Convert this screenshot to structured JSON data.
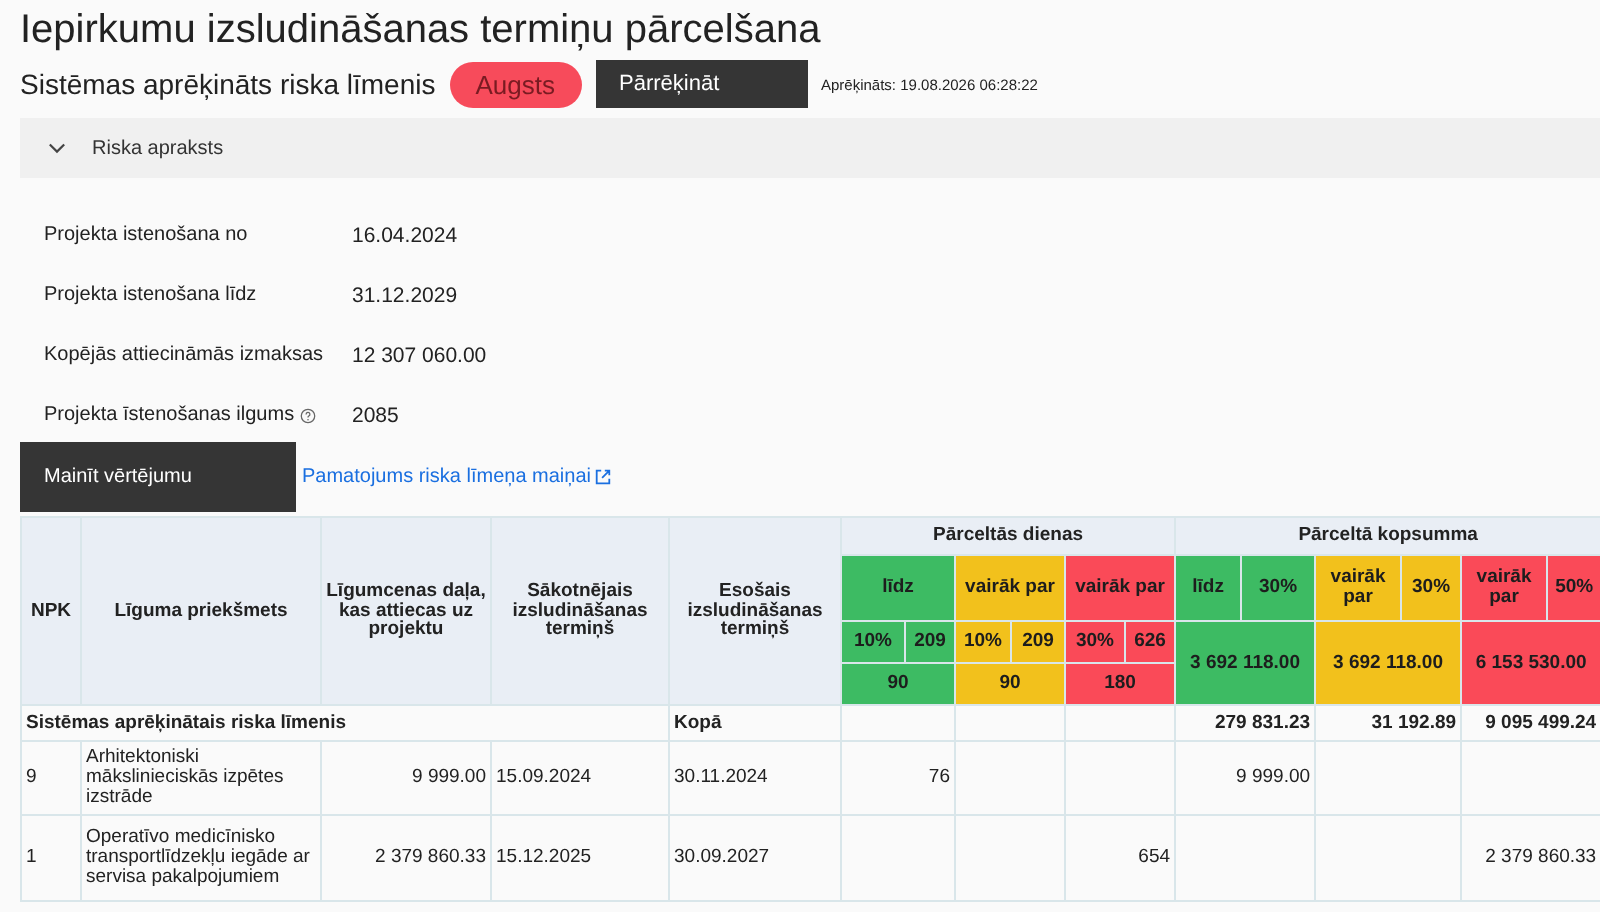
{
  "title": "Iepirkumu izsludināšanas termiņu pārcelšana",
  "risk": {
    "label": "Sistēmas aprēķināts riska līmenis",
    "value": "Augsts",
    "button": "Pārrēķināt",
    "calculated": "Aprēķināts: 19.08.2026 06:28:22"
  },
  "accordion": {
    "label": "Riska apraksts",
    "expanded": false
  },
  "fields": [
    {
      "label": "Projekta istenošana no",
      "value": "16.04.2024"
    },
    {
      "label": "Projekta istenošana līdz",
      "value": "31.12.2029"
    },
    {
      "label": "Kopējās attiecināmās izmaksas",
      "value": "12 307 060.00"
    },
    {
      "label": "Projekta īstenošanas ilgums",
      "value": "2085",
      "info": true
    }
  ],
  "change_button": "Mainīt vērtējumu",
  "link": "Pamatojums riska līmeņa maiņai",
  "table": {
    "columns": [
      "NPK",
      "Līguma priekšmets",
      "Līgumcenas daļa, kas attiecas uz projektu",
      "Sākotnējais izsludināšanas termiņš",
      "Esošais izsludināšanas termiņš"
    ],
    "days_header": "Pārceltās dienas",
    "sum_header": "Pārceltā kopsumma",
    "days_bands": [
      {
        "kind": "low",
        "label": "līdz",
        "percent": "10%",
        "days": "209",
        "limit": "90",
        "color": "#3dbb63"
      },
      {
        "kind": "mid",
        "label": "vairāk par",
        "percent": "10%",
        "days": "209",
        "limit": "90",
        "color": "#f2c11c"
      },
      {
        "kind": "high",
        "label": "vairāk par",
        "percent": "30%",
        "days": "626",
        "limit": "180",
        "color": "#fa4a58"
      }
    ],
    "sum_bands": [
      {
        "kind": "low",
        "label": "līdz",
        "percent": "30%",
        "amount": "3 692 118.00",
        "color": "#3dbb63"
      },
      {
        "kind": "mid",
        "label": "vairāk par",
        "percent": "30%",
        "amount": "3 692 118.00",
        "color": "#f2c11c"
      },
      {
        "kind": "high",
        "label": "vairāk par",
        "percent": "50%",
        "amount": "6 153 530.00",
        "color": "#fa4a58"
      }
    ],
    "summary": {
      "label": "Sistēmas aprēķinātais riska līmenis",
      "total_label": "Kopā",
      "sum_totals": [
        "279 831.23",
        "31 192.89",
        "9 095 499.24"
      ]
    },
    "rows": [
      {
        "npk": "9",
        "subject": "Arhitektoniski mākslinieciskās izpētes izstrāde",
        "amount": "9 999.00",
        "start": "15.09.2024",
        "current": "30.11.2024",
        "days": {
          "kind": "low",
          "value": "76"
        },
        "sums": {
          "kind": "low",
          "value": "9 999.00"
        }
      },
      {
        "npk": "1",
        "subject": "Operatīvo medicīnisko transportlīdzekļu iegāde ar servisa pakalpojumiem",
        "amount": "2 379 860.33",
        "start": "15.12.2025",
        "current": "30.09.2027",
        "days": {
          "kind": "high",
          "value": "654"
        },
        "sums": {
          "kind": "high",
          "value": "2 379 860.33"
        }
      }
    ]
  }
}
